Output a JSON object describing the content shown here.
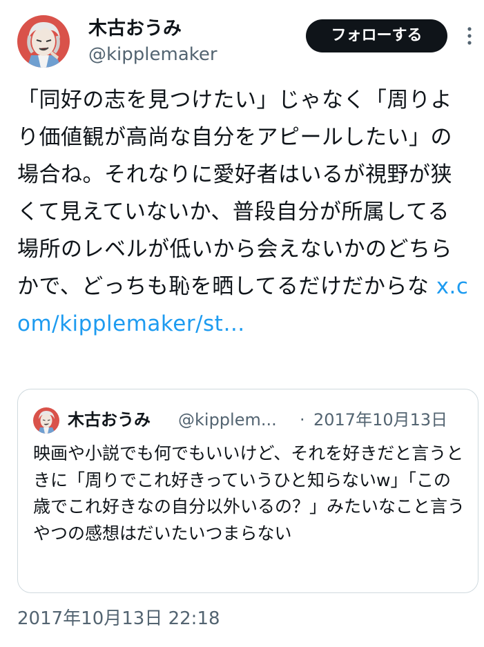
{
  "author": {
    "display_name": "木古おうみ",
    "handle": "@kipplemaker"
  },
  "actions": {
    "follow_label": "フォローする",
    "more_icon": "more-vertical-icon"
  },
  "tweet": {
    "text": "「同好の志を見つけたい」じゃなく「周りより価値観が高尚な自分をアピールしたい」の場合ね。それなりに愛好者はいるが視野が狭くて見えていないか、普段自分が所属してる場所のレベルが低いから会えないかのどちらかで、どっちも恥を晒してるだけだからな ",
    "link_text": "x.com/kipplemaker/st…",
    "timestamp": "2017年10月13日 22:18"
  },
  "quoted": {
    "display_name": "木古おうみ",
    "handle": "@kipplem...",
    "separator": "·",
    "date": "2017年10月13日",
    "text": "映画や小説でも何でもいいけど、それを好きだと言うときに「周りでこれ好きっていうひと知らないw」「この歳でこれ好きなの自分以外いるの？」みたいなこと言うやつの感想はだいたいつまらない"
  },
  "colors": {
    "text": "#0f1419",
    "secondary": "#536471",
    "link": "#1d9bf0",
    "button_bg": "#0f1419",
    "border": "#cfd9de"
  }
}
